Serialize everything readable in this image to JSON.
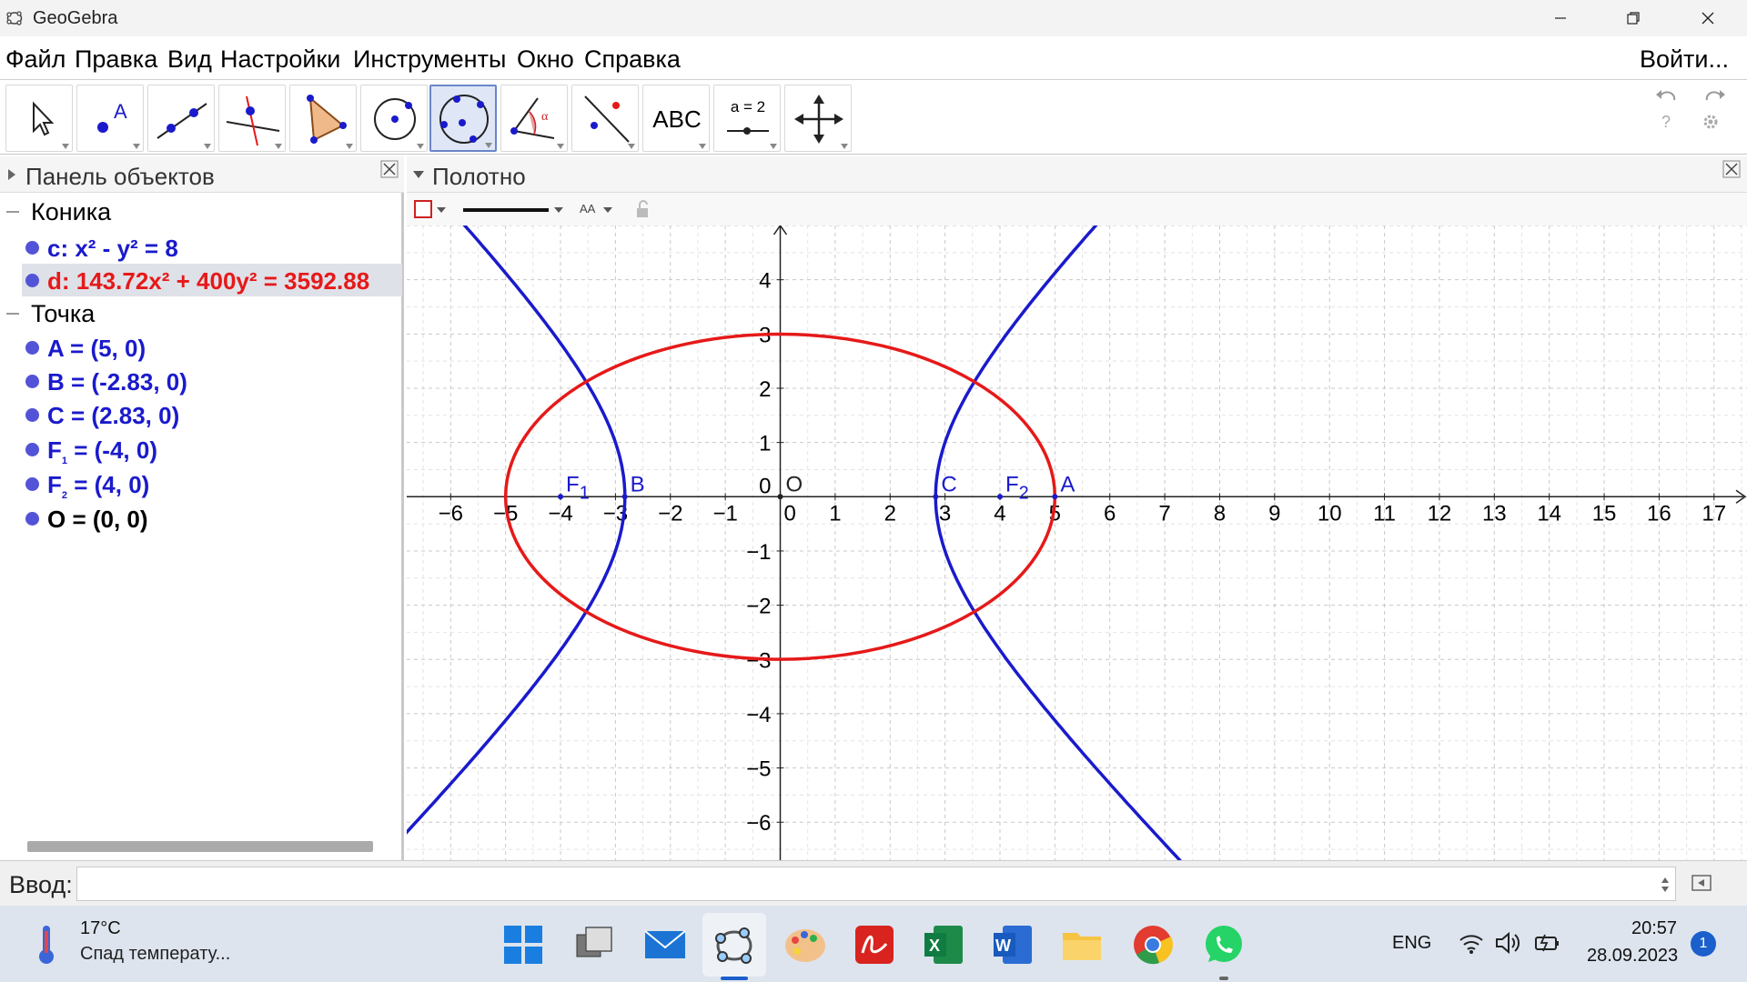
{
  "window": {
    "title": "GeoGebra"
  },
  "menu": {
    "items": [
      "Файл",
      "Правка",
      "Вид",
      "Настройки",
      "Инструменты",
      "Окно",
      "Справка"
    ],
    "login": "Войти..."
  },
  "toolbar": {
    "tools": [
      "move-tool",
      "point-tool",
      "line-tool",
      "perpendicular-tool",
      "polygon-tool",
      "circle-tool",
      "conic-tool",
      "angle-tool",
      "reflect-tool",
      "text-tool",
      "slider-tool",
      "move-graphics-tool"
    ],
    "text_label": "ABC",
    "slider_label": "a = 2"
  },
  "algebra": {
    "title": "Панель объектов",
    "groups": [
      {
        "label": "Коника",
        "items": [
          {
            "text": "c: x² - y² = 8",
            "color": "#1a1acc"
          },
          {
            "text": "d: 143.72x² + 400y² = 3592.88",
            "color": "#e61919"
          }
        ]
      },
      {
        "label": "Точка",
        "items": [
          {
            "text": "A = (5, 0)",
            "color": "#1a1acc"
          },
          {
            "text": "B = (-2.83, 0)",
            "color": "#1a1acc"
          },
          {
            "text": "C = (2.83, 0)",
            "color": "#1a1acc"
          },
          {
            "name": "F",
            "sub": "1",
            "rest": " = (-4, 0)",
            "color": "#1a1acc"
          },
          {
            "name": "F",
            "sub": "2",
            "rest": " = (4, 0)",
            "color": "#1a1acc"
          },
          {
            "text": "O = (0, 0)",
            "color": "#000000"
          }
        ]
      }
    ]
  },
  "graphics": {
    "title": "Полотно",
    "style_bar": {
      "text_size_label": "AA"
    }
  },
  "chart_data": {
    "type": "scatter",
    "x_ticks": [
      "−6",
      "−5",
      "−4",
      "−3",
      "−2",
      "−1",
      "0",
      "1",
      "2",
      "3",
      "4",
      "5",
      "6",
      "7",
      "8",
      "9",
      "10",
      "11",
      "12",
      "13",
      "14",
      "15",
      "16",
      "17"
    ],
    "y_ticks": [
      "4",
      "3",
      "2",
      "1",
      "0",
      "−1",
      "−2",
      "−3",
      "−4",
      "−5",
      "−6"
    ],
    "xlim": [
      -6.8,
      17.6
    ],
    "ylim": [
      -6.7,
      5.0
    ],
    "grid": true,
    "curves": [
      {
        "name": "c",
        "kind": "hyperbola",
        "equation": "x² - y² = 8",
        "color": "#1a1acc"
      },
      {
        "name": "d",
        "kind": "ellipse",
        "equation": "143.72x² + 400y² = 3592.88",
        "color": "#e61919"
      }
    ],
    "points": [
      {
        "label": "A",
        "x": 5,
        "y": 0
      },
      {
        "label": "B",
        "x": -2.83,
        "y": 0
      },
      {
        "label": "C",
        "x": 2.83,
        "y": 0
      },
      {
        "label": "F",
        "sub": "1",
        "x": -4,
        "y": 0
      },
      {
        "label": "F",
        "sub": "2",
        "x": 4,
        "y": 0
      },
      {
        "label": "O",
        "x": 0,
        "y": 0
      }
    ]
  },
  "input": {
    "label": "Ввод:"
  },
  "taskbar": {
    "weather_temp": "17°C",
    "weather_desc": "Спад температу...",
    "language": "ENG",
    "time": "20:57",
    "date": "28.09.2023",
    "notifications": "1"
  }
}
